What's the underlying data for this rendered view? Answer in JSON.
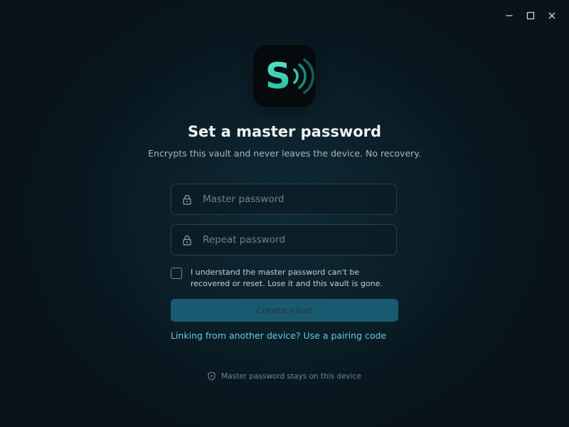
{
  "window": {
    "controls": {
      "minimize": "minimize-icon",
      "maximize": "maximize-icon",
      "close": "close-icon"
    }
  },
  "brand": {
    "logo_letter": "S",
    "logo_icon": "signal-waves-icon",
    "accent": "#39d3b4"
  },
  "heading": {
    "title": "Set a master password",
    "subtitle": "Encrypts this vault and never leaves the device. No recovery."
  },
  "form": {
    "master_password": {
      "placeholder": "Master password",
      "value": "",
      "icon": "lock-icon"
    },
    "repeat_password": {
      "placeholder": "Repeat password",
      "value": "",
      "icon": "lock-icon"
    },
    "acknowledge": {
      "checked": false,
      "label": "I understand the master password can't be recovered or reset. Lose it and this vault is gone."
    },
    "submit": {
      "label": "Create vault",
      "disabled": true
    }
  },
  "pairing": {
    "link_label": "Linking from another device? Use a pairing code"
  },
  "footer": {
    "icon": "shield-icon",
    "note": "Master password stays on this device"
  },
  "colors": {
    "background": "#0b1c24",
    "button": "#1a5a71",
    "link": "#6cc6e5"
  }
}
